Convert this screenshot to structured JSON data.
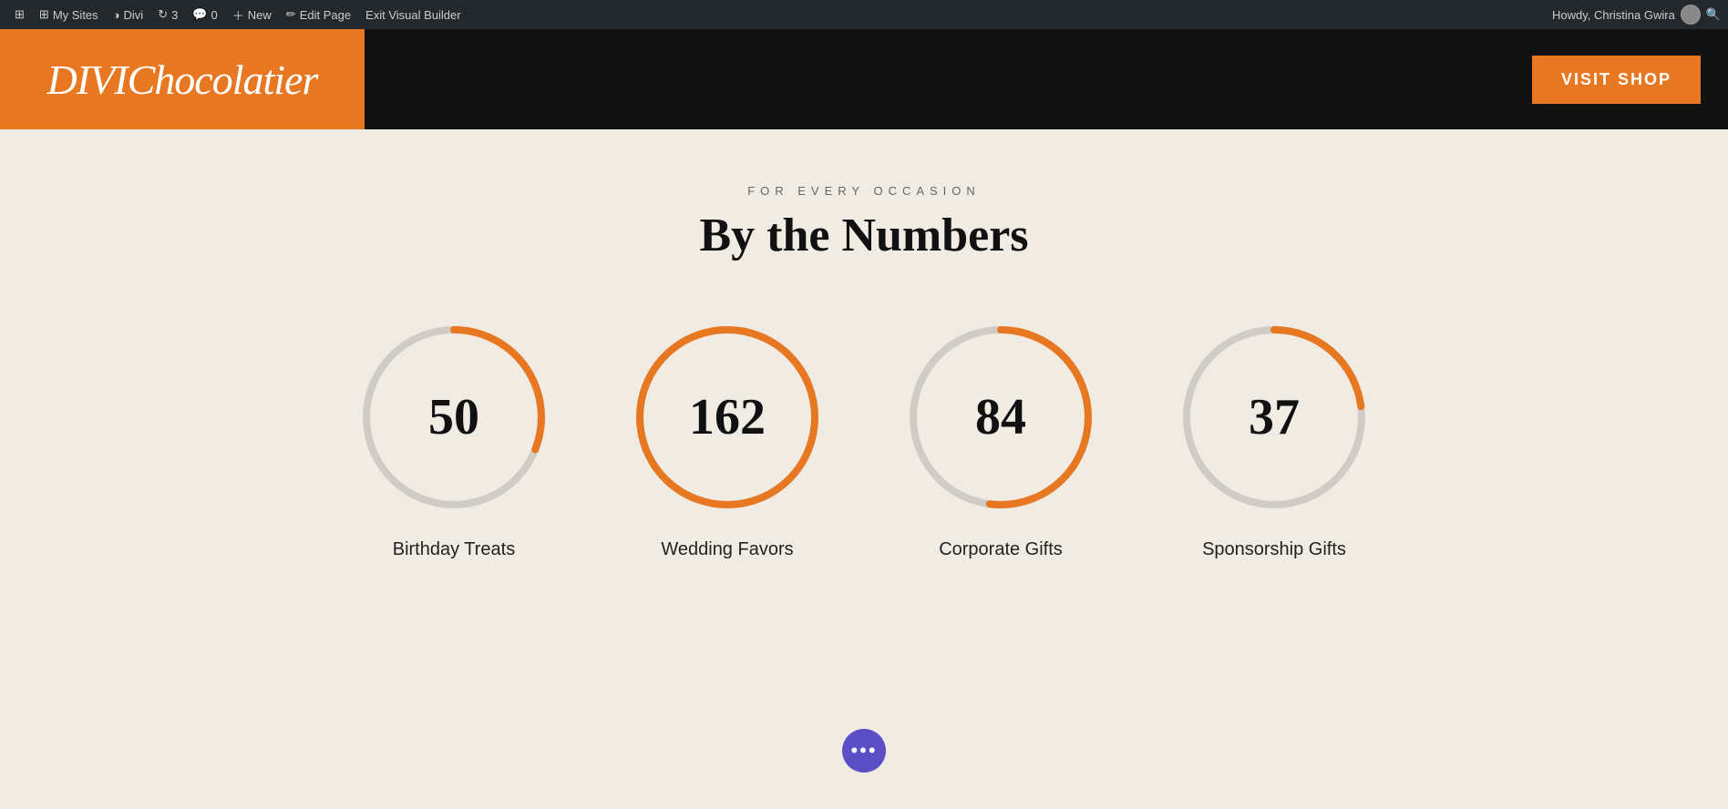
{
  "admin_bar": {
    "wp_label": "⊞",
    "my_sites_label": "My Sites",
    "divi_label": "Divi",
    "updates_count": "3",
    "comments_count": "0",
    "new_label": "New",
    "edit_page_label": "Edit Page",
    "exit_vb_label": "Exit Visual Builder",
    "howdy_label": "Howdy, Christina Gwira",
    "search_icon": "🔍"
  },
  "header": {
    "logo_bold": "DIVI",
    "logo_script": "Chocolatier",
    "visit_shop_label": "VISIT SHOP"
  },
  "section": {
    "subtitle": "FOR EVERY OCCASION",
    "title": "By the Numbers"
  },
  "stats": [
    {
      "value": 50,
      "max": 162,
      "label": "Birthday Treats",
      "percentage": 31
    },
    {
      "value": 162,
      "max": 162,
      "label": "Wedding Favors",
      "percentage": 100
    },
    {
      "value": 84,
      "max": 162,
      "label": "Corporate Gifts",
      "percentage": 52
    },
    {
      "value": 37,
      "max": 162,
      "label": "Sponsorship Gifts",
      "percentage": 23
    }
  ],
  "divi_btn": {
    "dots": "•••"
  },
  "colors": {
    "orange": "#e87722",
    "dark": "#111",
    "background": "#f0ece4",
    "purple": "#5b4fc7",
    "track": "#d0ccc5"
  }
}
